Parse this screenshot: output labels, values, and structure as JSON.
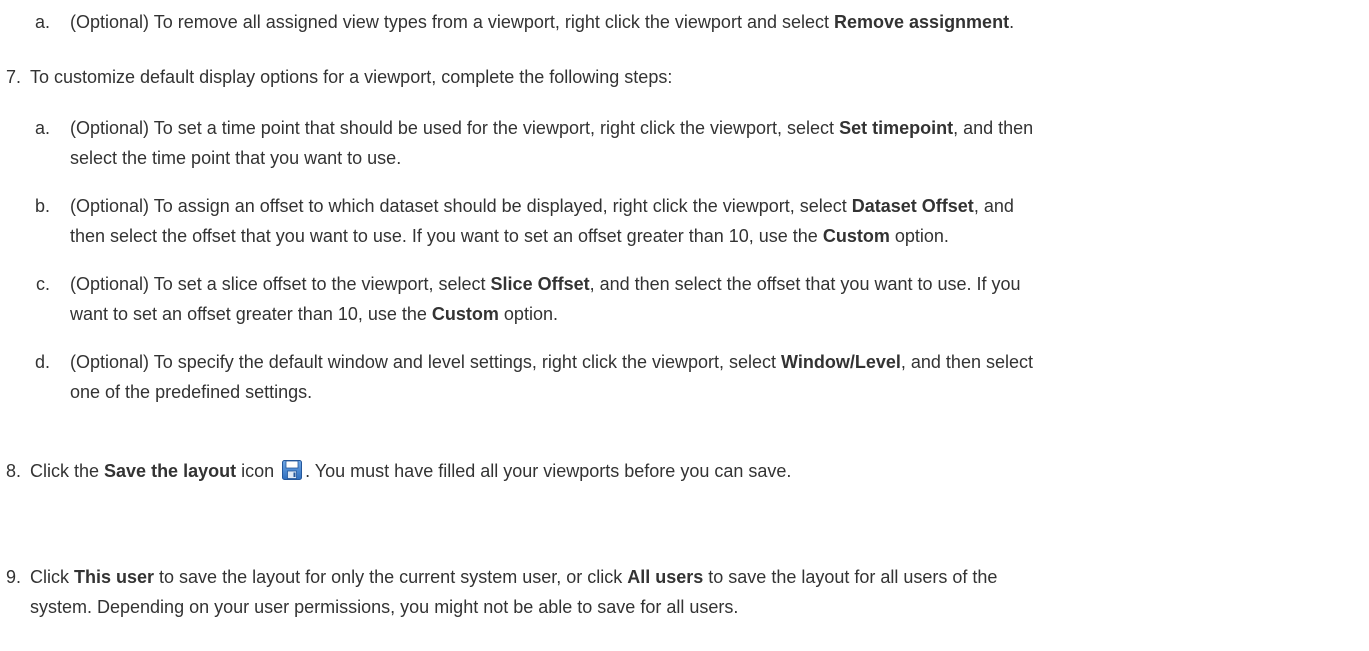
{
  "steps": {
    "s6a": {
      "marker": "a.",
      "t1": "(Optional) To remove all assigned view types from a viewport, right click the viewport and select ",
      "b1": "Remove assignment",
      "t2": "."
    },
    "s7": {
      "marker": "7.",
      "t1": "To customize default display options for a viewport, complete the following steps:"
    },
    "s7a": {
      "marker": "a.",
      "t1": "(Optional) To set a time point that should be used for the viewport, right click the viewport, select ",
      "b1": "Set timepoint",
      "t2": ", and then",
      "line2": "select the time point that you want to use."
    },
    "s7b": {
      "marker": "b.",
      "t1": "(Optional) To assign an offset to which dataset should be displayed, right click the viewport, select ",
      "b1": "Dataset Offset",
      "t2": ", and",
      "line2a": "then select the offset that you want to use. If you want to set an offset greater than 10, use the ",
      "b2": "Custom",
      "line2b": " option."
    },
    "s7c": {
      "marker": "c.",
      "t1": "(Optional) To set a slice offset to the viewport, select ",
      "b1": "Slice Offset",
      "t2": ", and then select the offset that you want to use. If you",
      "line2a": "want to set an offset greater than 10, use the ",
      "b2": "Custom",
      "line2b": " option."
    },
    "s7d": {
      "marker": "d.",
      "t1": "(Optional) To specify the default window and level settings, right click the viewport, select ",
      "b1": "Window/Level",
      "t2": ", and then select",
      "line2": "one of the predefined settings."
    },
    "s8": {
      "marker": "8.",
      "t1": "Click the ",
      "b1": "Save the layout",
      "t2": " icon ",
      "icon": "save-icon",
      "t3": ". You must have filled all your viewports before you can save."
    },
    "s9": {
      "marker": "9.",
      "t1": "Click ",
      "b1": "This user",
      "t2": " to save the layout for only the current system user, or click ",
      "b2": "All users",
      "t3": " to save the layout for all users of the",
      "line2": "system. Depending on your user permissions, you might not be able to save for all users."
    }
  }
}
